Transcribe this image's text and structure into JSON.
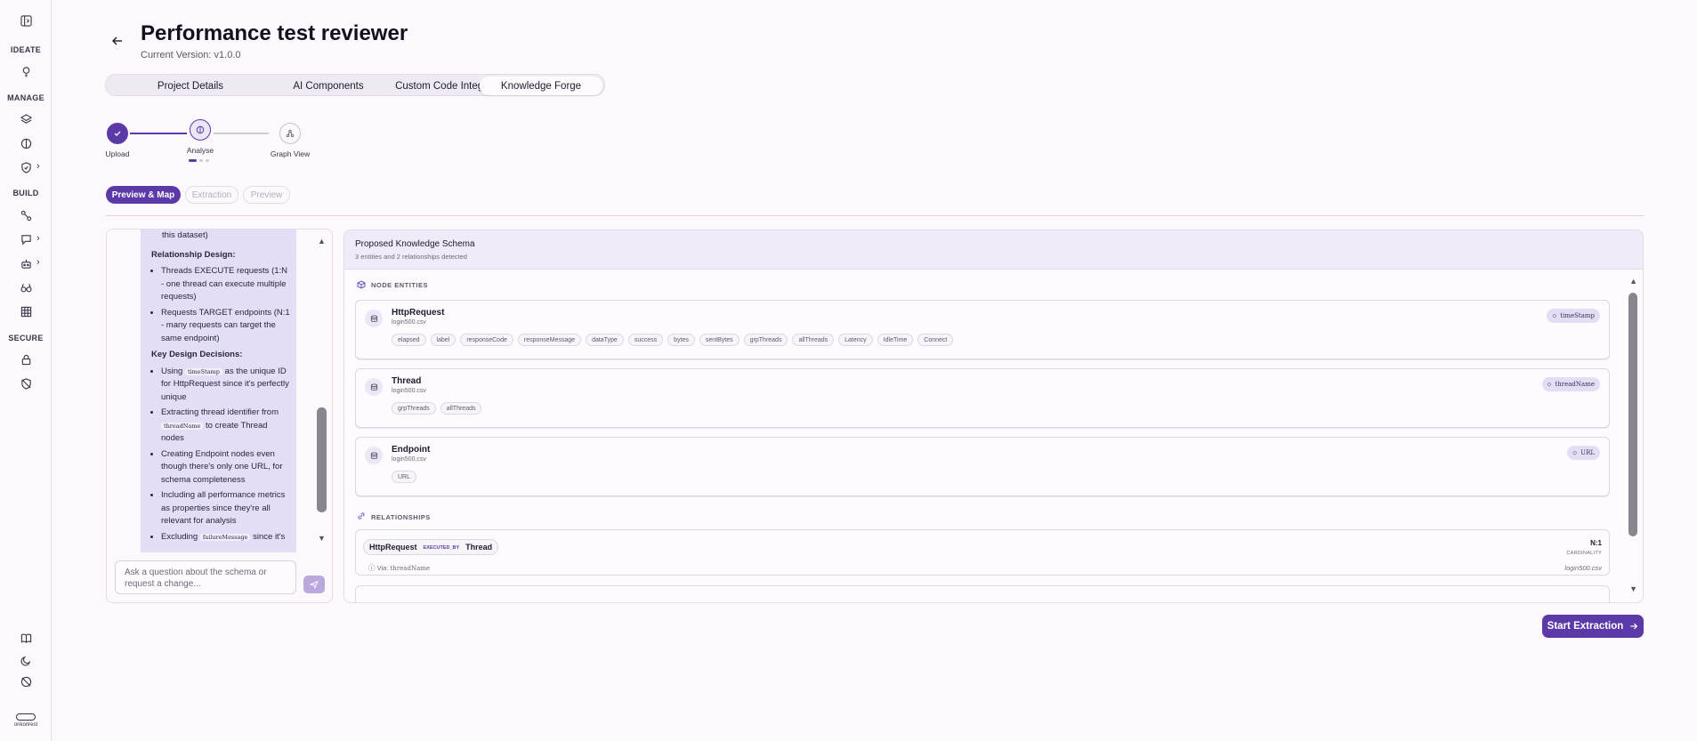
{
  "sidebar": {
    "sections": [
      "IDEATE",
      "MANAGE",
      "BUILD",
      "SECURE"
    ],
    "brand_text": "onkonrest",
    "icons": [
      "sidebar-toggle-icon",
      "lightbulb-icon",
      "layers-icon",
      "brain-icon",
      "shield-icon",
      "workflow-icon",
      "chat-icon",
      "bot-icon",
      "binoculars-icon",
      "table-icon",
      "lock-icon",
      "shield-off-icon",
      "book-icon",
      "moon-icon",
      "palette-off-icon"
    ]
  },
  "header": {
    "title": "Performance test reviewer",
    "version": "Current Version: v1.0.0"
  },
  "tabs": [
    "Project Details",
    "AI Components",
    "Custom Code Integration",
    "Knowledge Forge"
  ],
  "active_tab": "Knowledge Forge",
  "stepper": {
    "steps": [
      "Upload",
      "Analyse",
      "Graph View"
    ],
    "completed": 1,
    "current": 2
  },
  "subtabs": [
    "Preview & Map",
    "Extraction",
    "Preview"
  ],
  "chat": {
    "fragment": "this dataset)",
    "relationship_heading": "Relationship Design:",
    "relationship_items": [
      "Threads EXECUTE requests (1:N - one thread can execute multiple requests)",
      "Requests TARGET endpoints (N:1 - many requests can target the same endpoint)"
    ],
    "decisions_heading": "Key Design Decisions:",
    "decision_1_pre": "Using",
    "decision_1_code": "timeStamp",
    "decision_1_post": "as the unique ID for HttpRequest since it's perfectly unique",
    "decision_2_pre": "Extracting thread identifier from",
    "decision_2_code": "threadName",
    "decision_2_post": "to create Thread nodes",
    "decision_3": "Creating Endpoint nodes even though there's only one URL, for schema completeness",
    "decision_4": "Including all performance metrics as properties since they're all relevant for analysis",
    "decision_5_pre": "Excluding",
    "decision_5_code": "failureMessage",
    "decision_5_post": "since it's",
    "input_placeholder": "Ask a question about the schema or request a change..."
  },
  "schema": {
    "title": "Proposed Knowledge Schema",
    "subtitle": "3 entities and 2 relationships detected",
    "node_label": "NODE ENTITIES",
    "relationships_label": "RELATIONSHIPS",
    "entities": [
      {
        "name": "HttpRequest",
        "file": "login500.csv",
        "key": "timeStamp",
        "props": [
          "elapsed",
          "label",
          "responseCode",
          "responseMessage",
          "dataType",
          "success",
          "bytes",
          "sentBytes",
          "grpThreads",
          "allThreads",
          "Latency",
          "IdleTime",
          "Connect"
        ]
      },
      {
        "name": "Thread",
        "file": "login500.csv",
        "key": "threadName",
        "props": [
          "grpThreads",
          "allThreads"
        ]
      },
      {
        "name": "Endpoint",
        "file": "login500.csv",
        "key": "URL",
        "props": [
          "URL"
        ]
      }
    ],
    "relationship": {
      "from": "HttpRequest",
      "type": "EXECUTED_BY",
      "to": "Thread",
      "via_label": "Via:",
      "via": "threadName",
      "cardinality": "N:1",
      "cardinality_label": "CARDINALITY",
      "file": "login500.csv"
    }
  },
  "start_button": "Start Extraction",
  "colors": {
    "accent": "#5b3aa8",
    "bubble": "#e3def6",
    "background": "#fcf8fb"
  }
}
